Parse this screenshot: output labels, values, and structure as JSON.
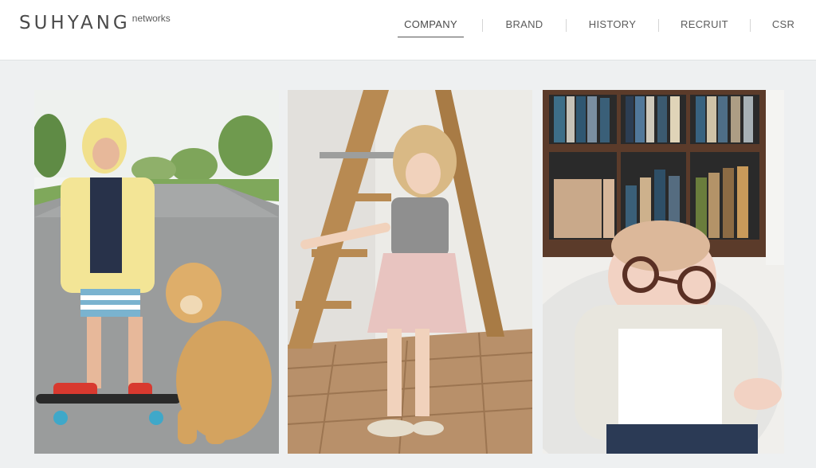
{
  "brand": {
    "name": "SUHYANG",
    "suffix": "networks"
  },
  "nav": [
    {
      "label": "COMPANY",
      "active": true
    },
    {
      "label": "BRAND",
      "active": false
    },
    {
      "label": "HISTORY",
      "active": false
    },
    {
      "label": "RECRUIT",
      "active": false
    },
    {
      "label": "CSR",
      "active": false
    }
  ],
  "photos": [
    {
      "name": "boy-with-dog-on-skateboard"
    },
    {
      "name": "girl-near-ladder-in-heels"
    },
    {
      "name": "baby-with-glasses-sleeping"
    }
  ],
  "colors": {
    "header_bg": "#ffffff",
    "page_bg": "#eef0f1",
    "text": "#5c5c5c"
  }
}
